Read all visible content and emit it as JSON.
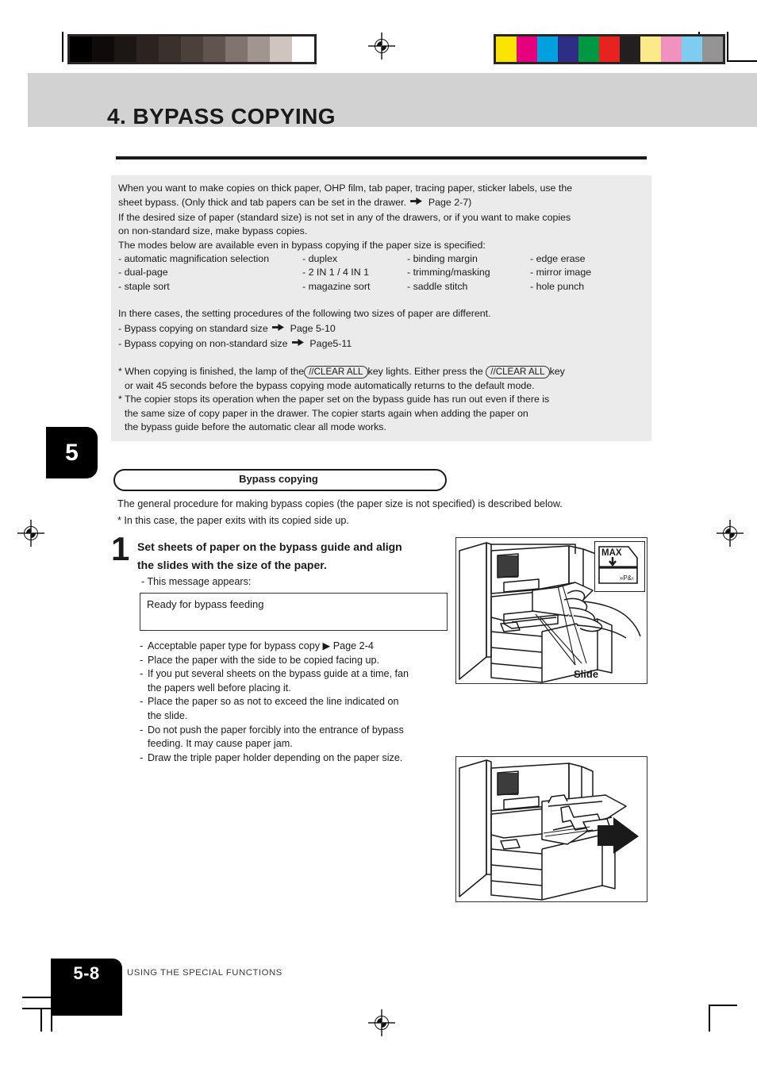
{
  "page": {
    "chapter_tab": "5",
    "header_title": "4. BYPASS COPYING",
    "footer_page": "5-8",
    "footer_label": "USING THE SPECIAL FUNCTIONS"
  },
  "intro": {
    "para1_line1": "When you want to make copies on thick paper, OHP film, tab paper, tracing paper, sticker labels, use the",
    "para1_line2_a": "sheet bypass.  (Only thick and tab papers can be set in the drawer.",
    "para1_line2_b": "Page 2-7)",
    "para2_line1": "If the desired size of paper (standard size) is not set in any of the drawers, or if you want to make copies",
    "para2_line2": "on non-standard size, make bypass copies.",
    "para3": "The modes below are available even in bypass copying if the paper size is specified:",
    "modes": [
      "- automatic magnification selection",
      "- duplex",
      "- binding margin",
      "- edge erase",
      "- dual-page",
      "- 2 IN 1 / 4 IN 1",
      "- trimming/masking",
      "- mirror image",
      "- staple sort",
      "- magazine sort",
      "- saddle stitch",
      "- hole punch"
    ],
    "para4": "In there cases, the setting procedures of the following two sizes of paper are different.",
    "ref1_text": "- Bypass copying on standard size",
    "ref1_page": "Page 5-10",
    "ref2_text": "- Bypass copying on non-standard size",
    "ref2_page": "Page5-11",
    "note1_a": "* When copying is finished, the lamp of the",
    "note1_key1": "//CLEAR ALL",
    "note1_b": "key lights.  Either press the",
    "note1_key2": "//CLEAR ALL",
    "note1_c": "key",
    "note1_line2": "or wait 45 seconds before the bypass copying mode automatically returns to the default mode.",
    "note2_line1": "* The copier stops its operation when the paper set on the bypass guide has run out even if there is",
    "note2_line2": "the same size of copy paper in the drawer. The copier starts again when adding the paper on",
    "note2_line3": "the bypass guide before the automatic clear all mode works."
  },
  "section": {
    "pill_label": "Bypass copying",
    "lead_line1": "The general procedure for making bypass copies (the paper size is not specified) is described below.",
    "lead_line2": "* In this case, the paper exits with its copied side up."
  },
  "step1": {
    "number": "1",
    "title_line1": "Set sheets of paper on the bypass guide and align",
    "title_line2": "the slides with the size of the paper.",
    "sub": "- This message appears:",
    "display_message": "Ready for bypass feeding",
    "bullets": [
      "Acceptable paper type for bypass copy ▶ Page 2-4",
      "Place the paper with the side to be copied facing up.",
      "If you put several sheets on the bypass guide at a time, fan",
      "the papers well before placing it.",
      "Place the paper so as not to exceed the line indicated on",
      "the slide.",
      "Do not push the paper forcibly into the entrance of bypass",
      "feeding. It may cause paper jam.",
      "Draw the triple paper holder depending on the paper size."
    ],
    "bullet_dashes": [
      true,
      true,
      true,
      false,
      true,
      false,
      true,
      false,
      true
    ]
  },
  "illustrations": {
    "figure1_caption": "Slide",
    "figure1_inset_label": "MAX",
    "figure1_inset_mark": "»P&‹",
    "figure2_caption": ""
  },
  "print_strip": {
    "gray_wedge": [
      "#000000",
      "#0e0b0a",
      "#1c1715",
      "#2a2320",
      "#3a302c",
      "#4c403b",
      "#61534d",
      "#81736d",
      "#a2948e",
      "#cfc4be",
      "#ffffff"
    ],
    "color_wedge": [
      "#fbe500",
      "#e6007e",
      "#00a0e0",
      "#2d2f87",
      "#009844",
      "#e6231e",
      "#231f20",
      "#fbe98a",
      "#f191c0",
      "#7ecdf0",
      "#949494"
    ]
  }
}
